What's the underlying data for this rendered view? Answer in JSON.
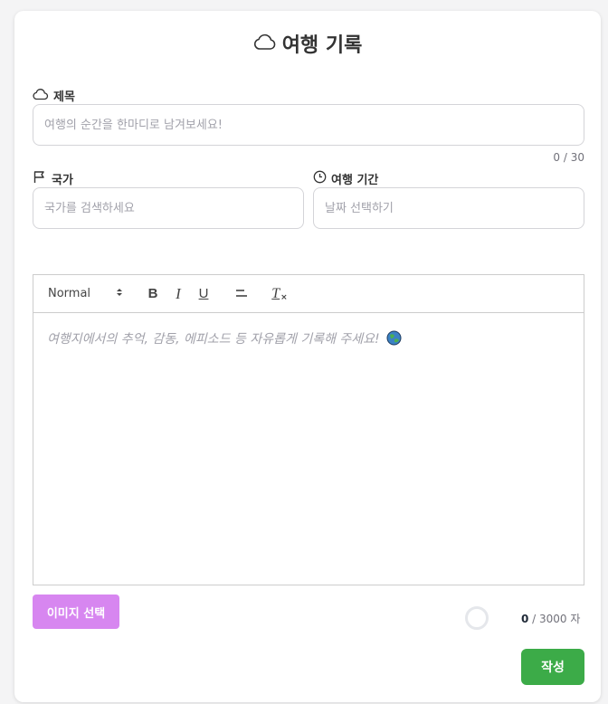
{
  "header": {
    "title": "여행 기록",
    "icon": "cloud-icon"
  },
  "title_field": {
    "label": "제목",
    "placeholder": "여행의 순간을 한마디로 남겨보세요!",
    "value": "",
    "counter": "0 / 30"
  },
  "country_field": {
    "label": "국가",
    "placeholder": "국가를 검색하세요",
    "value": ""
  },
  "period_field": {
    "label": "여행 기간",
    "placeholder": "날짜 선택하기",
    "value": ""
  },
  "editor": {
    "toolbar": {
      "header_select": "Normal",
      "bold": "B",
      "italic": "I",
      "underline": "U",
      "clean": "T"
    },
    "placeholder": "여행지에서의 추억, 감동, 에피소드 등 자유롭게 기록해 주세요!",
    "char_count": {
      "current": "0",
      "rest": " / 3000 자",
      "fraction": 0
    }
  },
  "actions": {
    "image_button": "이미지 선택",
    "submit_button": "작성"
  },
  "colors": {
    "image_button": "#d786f0",
    "submit_button": "#3cab48",
    "border": "#d4d4d8"
  }
}
